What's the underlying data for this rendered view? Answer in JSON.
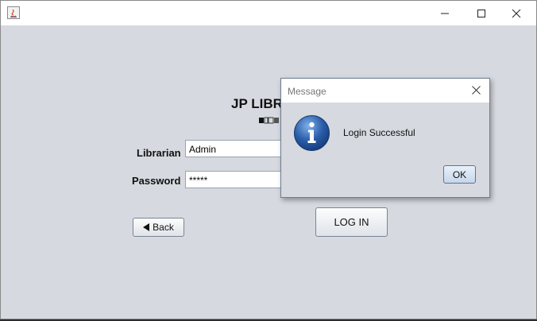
{
  "window": {
    "minimize_icon": "minimize-icon",
    "maximize_icon": "maximize-icon",
    "close_icon": "close-icon"
  },
  "form": {
    "title": "JP LIBR",
    "librarian_label": "Librarian",
    "librarian_value": "Admin",
    "password_label": "Password",
    "password_value": "*****",
    "back_label": "Back",
    "login_label": "LOG IN"
  },
  "dialog": {
    "title": "Message",
    "message": "Login Successful",
    "ok_label": "OK",
    "icon": "info-icon"
  },
  "colors": {
    "window_bg": "#d6d9df",
    "info_blue": "#2a5ca8"
  }
}
